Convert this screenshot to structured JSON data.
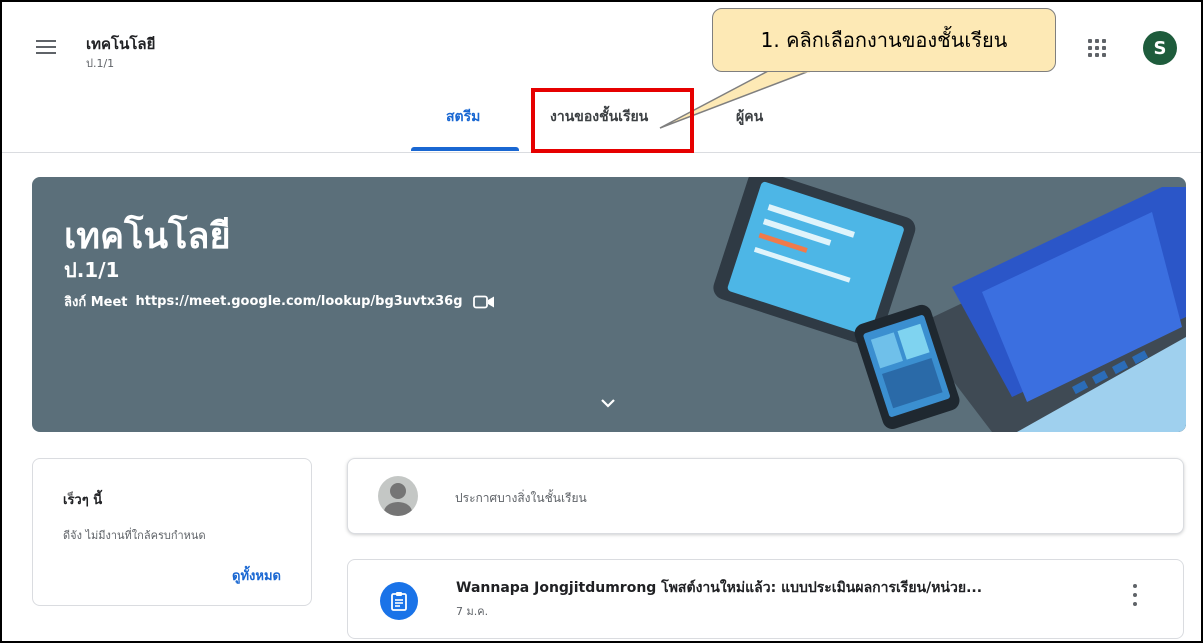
{
  "header": {
    "class_title": "เทคโนโลยี",
    "class_subtitle": "ป.1/1",
    "avatar_letter": "S",
    "icons": {
      "menu": "hamburger-menu-icon",
      "apps": "google-apps-icon"
    }
  },
  "tabs": [
    {
      "label": "สตรีม",
      "active": true
    },
    {
      "label": "งานของชั้นเรียน",
      "active": false
    },
    {
      "label": "ผู้คน",
      "active": false
    }
  ],
  "callout": {
    "text": "1. คลิกเลือกงานของชั้นเรียน"
  },
  "banner": {
    "title": "เทคโนโลยี",
    "subtitle": "ป.1/1",
    "meet_label": "ลิงก์ Meet",
    "meet_url": "https://meet.google.com/lookup/bg3uvtx36g",
    "color": "#5b6f7a"
  },
  "upcoming": {
    "title": "เร็วๆ นี้",
    "message": "ดีจัง ไม่มีงานที่ใกล้ครบกำหนด",
    "view_all": "ดูทั้งหมด"
  },
  "announce": {
    "placeholder": "ประกาศบางสิ่งในชั้นเรียน"
  },
  "post": {
    "title": "Wannapa Jongjitdumrong โพสต์งานใหม่แล้ว: แบบประเมินผลการเรียน/หน่วย...",
    "date": "7 ม.ค."
  },
  "colors": {
    "accent": "#1967d2",
    "highlight": "#e60000",
    "callout_bg": "#fde9b5",
    "avatar_bg": "#1e5c3c"
  }
}
